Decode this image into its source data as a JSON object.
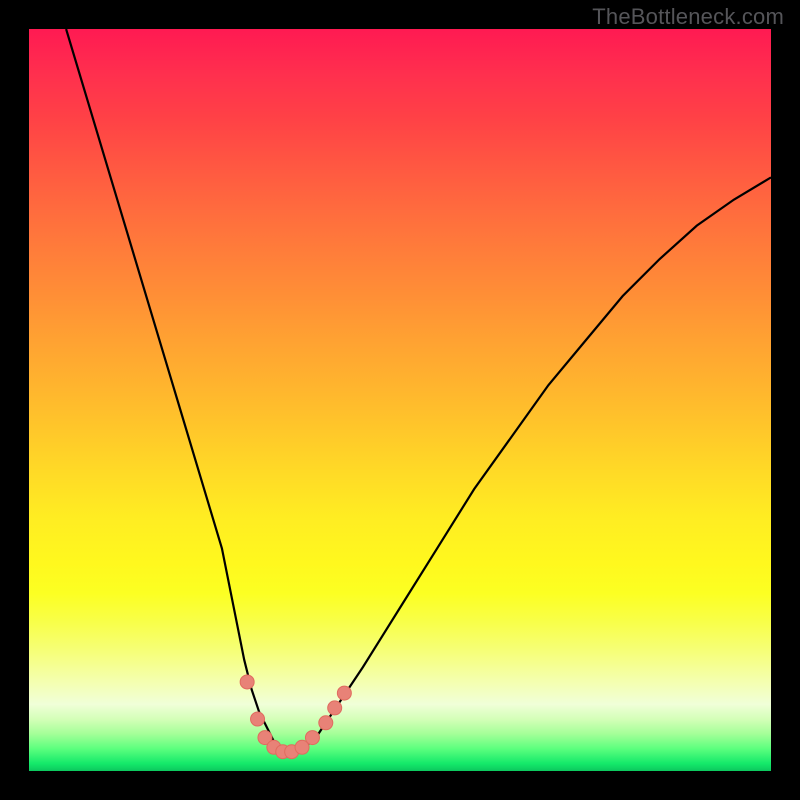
{
  "watermark": "TheBottleneck.com",
  "colors": {
    "frame": "#000000",
    "curve": "#000000",
    "marker_fill": "#e88277",
    "marker_stroke": "#e06b5f"
  },
  "chart_data": {
    "type": "line",
    "title": "",
    "xlabel": "",
    "ylabel": "",
    "xlim": [
      0,
      100
    ],
    "ylim": [
      0,
      100
    ],
    "grid": false,
    "legend": false,
    "series": [
      {
        "name": "curve",
        "x": [
          5,
          8,
          11,
          14,
          17,
          20,
          23,
          26,
          29,
          30,
          31,
          32,
          33,
          34,
          35,
          36,
          37,
          38,
          39,
          40,
          42,
          45,
          50,
          55,
          60,
          65,
          70,
          75,
          80,
          85,
          90,
          95,
          100
        ],
        "y": [
          100,
          90,
          80,
          70,
          60,
          50,
          40,
          30,
          15,
          11,
          8,
          6,
          4,
          3,
          2.5,
          2.5,
          3,
          4,
          5,
          6.5,
          9.5,
          14,
          22,
          30,
          38,
          45,
          52,
          58,
          64,
          69,
          73.5,
          77,
          80
        ]
      }
    ],
    "markers": [
      {
        "x": 29.4,
        "y": 12.0
      },
      {
        "x": 30.8,
        "y": 7.0
      },
      {
        "x": 31.8,
        "y": 4.5
      },
      {
        "x": 33.0,
        "y": 3.2
      },
      {
        "x": 34.2,
        "y": 2.6
      },
      {
        "x": 35.4,
        "y": 2.6
      },
      {
        "x": 36.8,
        "y": 3.2
      },
      {
        "x": 38.2,
        "y": 4.5
      },
      {
        "x": 40.0,
        "y": 6.5
      },
      {
        "x": 41.2,
        "y": 8.5
      },
      {
        "x": 42.5,
        "y": 10.5
      }
    ]
  }
}
